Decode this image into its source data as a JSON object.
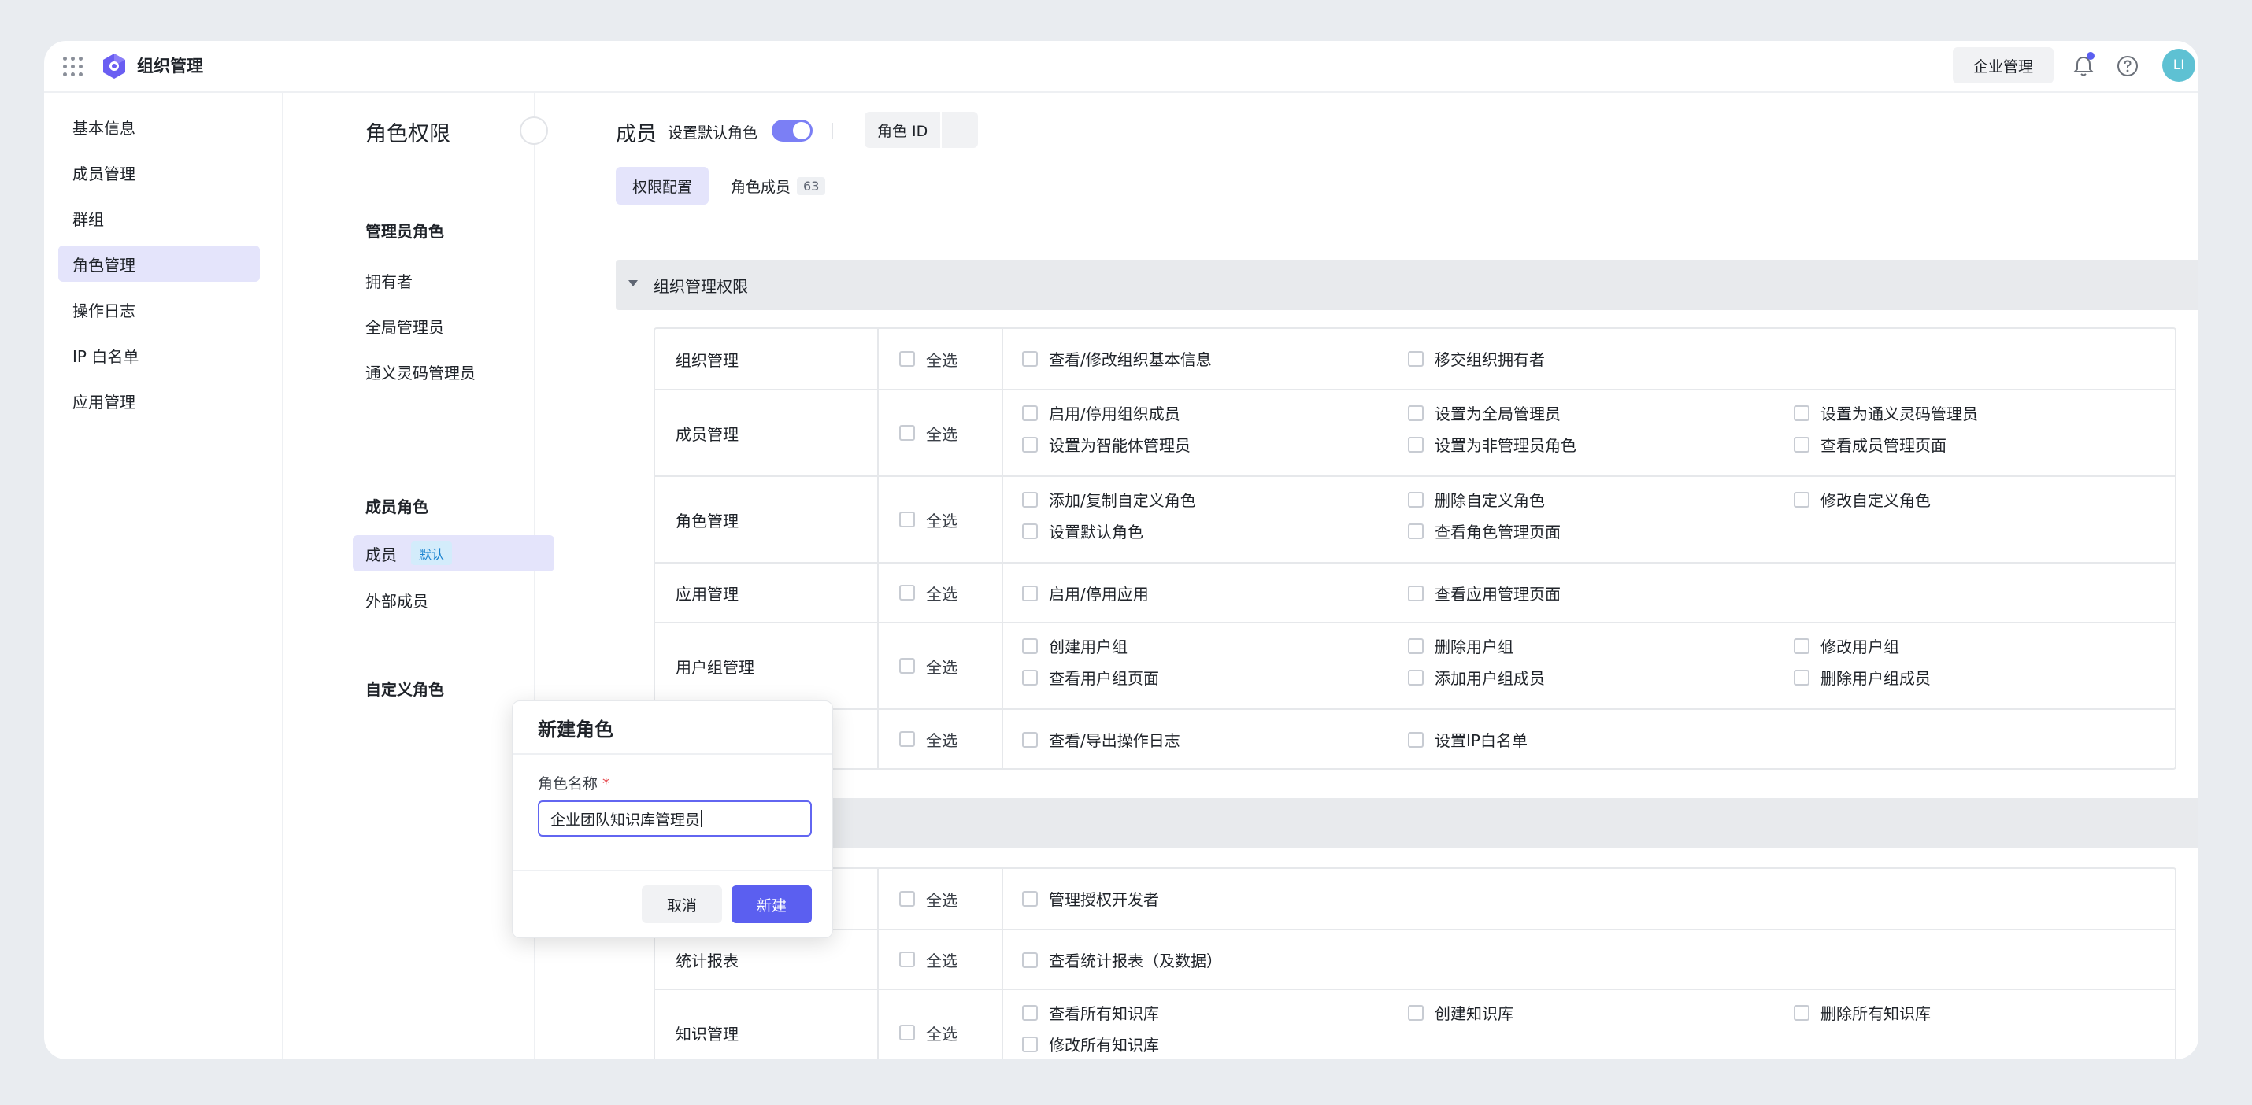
{
  "app": {
    "title": "组织管理"
  },
  "topbar": {
    "enterprise_button": "企业管理",
    "avatar_initials": "LI"
  },
  "sidebar": {
    "items": [
      {
        "label": "基本信息",
        "active": false
      },
      {
        "label": "成员管理",
        "active": false
      },
      {
        "label": "群组",
        "active": false
      },
      {
        "label": "角色管理",
        "active": true
      },
      {
        "label": "操作日志",
        "active": false
      },
      {
        "label": "IP 白名单",
        "active": false
      },
      {
        "label": "应用管理",
        "active": false
      }
    ]
  },
  "roles": {
    "title": "角色权限",
    "admin_group": "管理员角色",
    "admin_roles": [
      "拥有者",
      "全局管理员",
      "通义灵码管理员"
    ],
    "member_group": "成员角色",
    "member_roles": [
      {
        "label": "成员",
        "badge": "默认"
      },
      {
        "label": "外部成员"
      }
    ],
    "custom_group": "自定义角色"
  },
  "main": {
    "title": "成员",
    "default_role_label": "设置默认角色",
    "default_role_enabled": true,
    "role_id_label": "角色 ID",
    "tabs": [
      {
        "label": "权限配置",
        "active": true
      },
      {
        "label": "角色成员",
        "count": "63"
      }
    ],
    "sections": [
      {
        "title": "组织管理权限",
        "expanded": true
      },
      {
        "title": "",
        "expanded": true
      }
    ],
    "select_all": "全选",
    "table1": [
      {
        "name": "组织管理",
        "perms": [
          "查看/修改组织基本信息",
          "移交组织拥有者"
        ]
      },
      {
        "name": "成员管理",
        "perms": [
          "启用/停用组织成员",
          "设置为全局管理员",
          "设置为通义灵码管理员",
          "设置为智能体管理员",
          "设置为非管理员角色",
          "查看成员管理页面"
        ]
      },
      {
        "name": "角色管理",
        "perms": [
          "添加/复制自定义角色",
          "删除自定义角色",
          "修改自定义角色",
          "设置默认角色",
          "查看角色管理页面"
        ]
      },
      {
        "name": "应用管理",
        "perms": [
          "启用/停用应用",
          "查看应用管理页面"
        ]
      },
      {
        "name": "用户组管理",
        "perms": [
          "创建用户组",
          "删除用户组",
          "修改用户组",
          "查看用户组页面",
          "添加用户组成员",
          "删除用户组成员"
        ]
      },
      {
        "name": "",
        "perms": [
          "查看/导出操作日志",
          "设置IP白名单"
        ]
      }
    ],
    "table2": [
      {
        "name": "",
        "perms": [
          "管理授权开发者"
        ]
      },
      {
        "name": "统计报表",
        "perms": [
          "查看统计报表（及数据）"
        ]
      },
      {
        "name": "知识管理",
        "perms": [
          "查看所有知识库",
          "创建知识库",
          "删除所有知识库",
          "修改所有知识库"
        ]
      }
    ]
  },
  "modal": {
    "title": "新建角色",
    "field_label": "角色名称",
    "required_mark": "*",
    "field_value": "企业团队知识库管理员",
    "cancel": "取消",
    "confirm": "新建"
  }
}
